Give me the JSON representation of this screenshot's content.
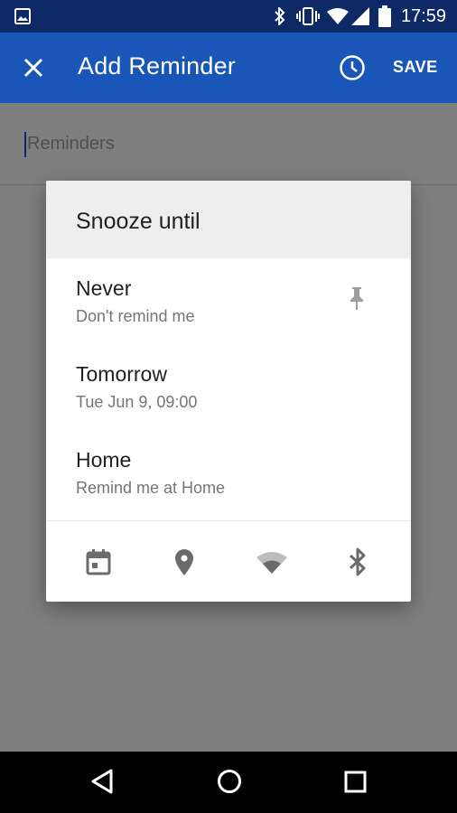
{
  "status_bar": {
    "time": "17:59",
    "icons": [
      "image-icon",
      "bluetooth-icon",
      "vibrate-icon",
      "wifi-icon",
      "signal-icon",
      "battery-icon"
    ]
  },
  "toolbar": {
    "title": "Add Reminder",
    "save_label": "SAVE",
    "icons": [
      "close-icon",
      "clock-icon"
    ]
  },
  "content": {
    "placeholder": "Reminders"
  },
  "dialog": {
    "title": "Snooze until",
    "options": [
      {
        "label": "Never",
        "sublabel": "Don't remind me",
        "icon": "pin-icon"
      },
      {
        "label": "Tomorrow",
        "sublabel": "Tue Jun 9, 09:00"
      },
      {
        "label": "Home",
        "sublabel": "Remind me at Home"
      }
    ],
    "actions": [
      "calendar-icon",
      "location-icon",
      "wifi-icon",
      "bluetooth-icon"
    ]
  },
  "nav_bar": {
    "buttons": [
      "back-icon",
      "home-icon",
      "recents-icon"
    ]
  },
  "colors": {
    "status_bar": "#0d2a66",
    "toolbar": "#1a55b8",
    "dialog_header": "#eeeeee",
    "icon_gray": "#757575"
  }
}
